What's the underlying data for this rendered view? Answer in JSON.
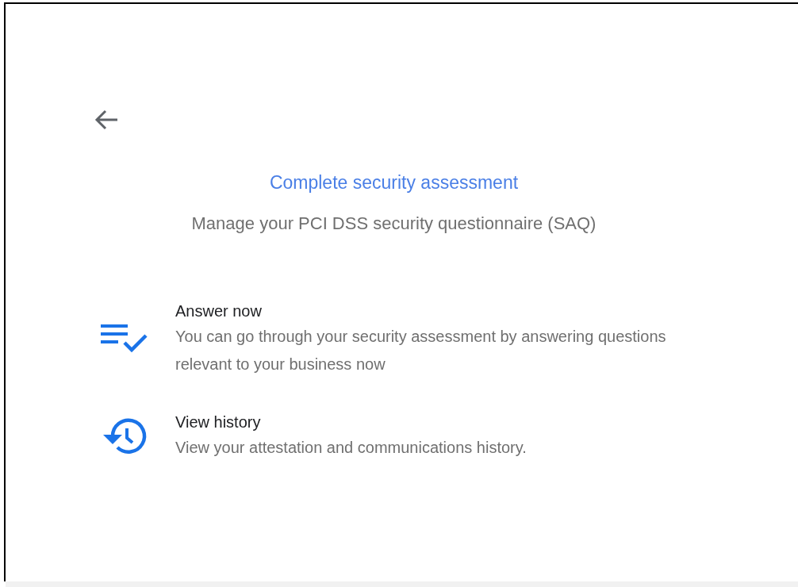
{
  "header": {
    "title": "Complete security assessment",
    "subtitle": "Manage your PCI DSS security questionnaire (SAQ)"
  },
  "options": [
    {
      "kind": "checklist",
      "title": "Answer now",
      "description": "You can go through your security assessment by answering questions relevant to your business now"
    },
    {
      "kind": "history",
      "title": "View history",
      "description": "View your attestation and communications history."
    }
  ]
}
